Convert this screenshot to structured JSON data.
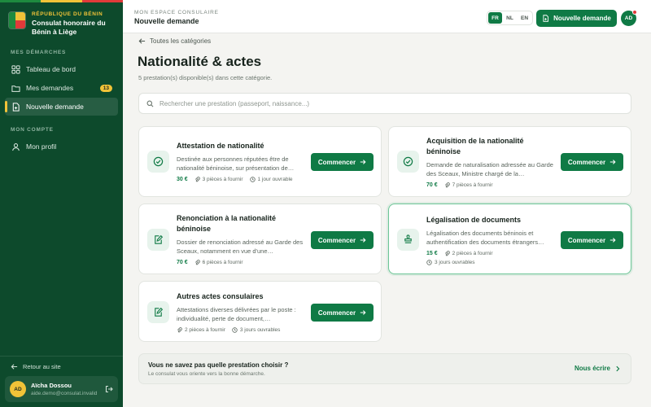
{
  "colors": {
    "primary": "#0f7a45",
    "sidebar": "#0d4a2c",
    "accent": "#f1c338",
    "flag_green": "#1e8a3f",
    "flag_yellow": "#f1c338",
    "flag_red": "#e03a3a"
  },
  "sidebar": {
    "kicker": "RÉPUBLIQUE DU BÉNIN",
    "name": "Consulat honoraire du Bénin à Liège",
    "section_demarches": "MES DÉMARCHES",
    "items": [
      {
        "label": "Tableau de bord",
        "icon": "grid-icon"
      },
      {
        "label": "Mes demandes",
        "icon": "folder-icon",
        "badge": "13"
      },
      {
        "label": "Nouvelle demande",
        "icon": "file-plus-icon",
        "active": true
      }
    ],
    "section_compte": "MON COMPTE",
    "profile": {
      "label": "Mon profil",
      "icon": "user-icon"
    },
    "back_site": "Retour au site",
    "user": {
      "initials": "AD",
      "name": "Aïcha Dossou",
      "email": "aide.demo@consulat.invalid"
    }
  },
  "topbar": {
    "kicker": "MON ESPACE CONSULAIRE",
    "title": "Nouvelle demande",
    "langs": [
      "FR",
      "NL",
      "EN"
    ],
    "active_lang": "FR",
    "new_request": "Nouvelle demande",
    "avatar": "AD"
  },
  "main": {
    "back": "Toutes les catégories",
    "title": "Nationalité & actes",
    "subtitle": "5 prestation(s) disponible(s) dans cette catégorie.",
    "search_placeholder": "Rechercher une prestation (passeport, naissance...)",
    "start_label": "Commencer",
    "cards": [
      {
        "title": "Attestation de nationalité",
        "desc": "Destinée aux personnes réputées être de nationalité béninoise, sur présentation de…",
        "price": "30 €",
        "docs": "3 pièces à fournir",
        "delay": "1 jour ouvrable",
        "icon": "check-circle-icon"
      },
      {
        "title": "Acquisition de la nationalité béninoise",
        "desc": "Demande de naturalisation adressée au Garde des Sceaux, Ministre chargé de la…",
        "price": "70 €",
        "docs": "7 pièces à fournir",
        "delay": "",
        "icon": "check-circle-icon"
      },
      {
        "title": "Renonciation à la nationalité béninoise",
        "desc": "Dossier de renonciation adressé au Garde des Sceaux, notamment en vue d'une…",
        "price": "70 €",
        "docs": "6 pièces à fournir",
        "delay": "",
        "icon": "edit-doc-icon"
      },
      {
        "title": "Légalisation de documents",
        "desc": "Légalisation des documents béninois et authentification des documents étrangers…",
        "price": "15 €",
        "docs": "2 pièces à fournir",
        "delay": "3 jours ouvrables",
        "icon": "stamp-icon",
        "highlighted": true
      },
      {
        "title": "Autres actes consulaires",
        "desc": "Attestations diverses délivrées par le poste : individualité, perte de document,…",
        "price": "",
        "docs": "2 pièces à fournir",
        "delay": "3 jours ouvrables",
        "icon": "edit-doc-icon"
      }
    ],
    "help": {
      "title": "Vous ne savez pas quelle prestation choisir ?",
      "subtitle": "Le consulat vous oriente vers la bonne démarche.",
      "link": "Nous écrire"
    }
  }
}
